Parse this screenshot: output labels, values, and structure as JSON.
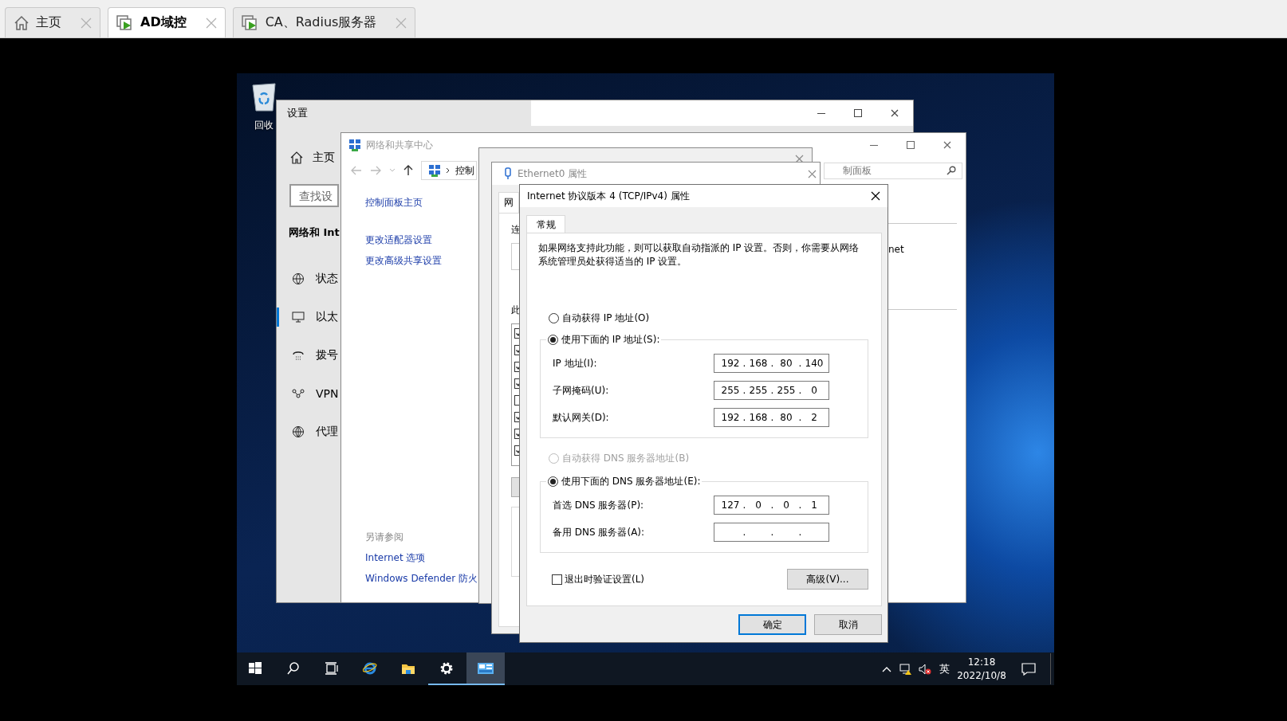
{
  "browser_tabs": [
    {
      "label": "主页",
      "kind": "home",
      "selected": false
    },
    {
      "label": "AD域控",
      "kind": "vm",
      "selected": true
    },
    {
      "label": "CA、Radius服务器",
      "kind": "vm",
      "selected": false
    }
  ],
  "desktop_icons": [
    {
      "label": "回收",
      "kind": "recycle"
    }
  ],
  "settings_window": {
    "title": "设置",
    "home_label": "主页",
    "search_placeholder": "查找设",
    "section_title": "网络和 Int",
    "nav": [
      {
        "label": "状态",
        "kind": "status",
        "selected": false
      },
      {
        "label": "以太",
        "kind": "ethernet",
        "selected": true
      },
      {
        "label": "拨号",
        "kind": "dialup",
        "selected": false
      },
      {
        "label": "VPN",
        "kind": "vpn",
        "selected": false
      },
      {
        "label": "代理",
        "kind": "proxy",
        "selected": false
      }
    ]
  },
  "network_center": {
    "title": "网络和共享中心",
    "address": "控制",
    "search_placeholder": "制面板",
    "links": [
      "控制面板主页",
      "更改适配器设置",
      "更改高级共享设置"
    ],
    "see_also_title": "另请参阅",
    "see_also": [
      "Internet 选项",
      "Windows Defender 防火"
    ],
    "right_text": "net"
  },
  "properties_window": {
    "title": "Ethernet0 属性",
    "tab": "网",
    "connect_label": "连",
    "items_label": "此",
    "items": [
      {
        "checked": true
      },
      {
        "checked": true
      },
      {
        "checked": true
      },
      {
        "checked": true
      },
      {
        "checked": false
      },
      {
        "checked": true
      },
      {
        "checked": true
      },
      {
        "checked": true
      }
    ]
  },
  "ipv4_dialog": {
    "title": "Internet 协议版本 4 (TCP/IPv4) 属性",
    "tabs": [
      {
        "label": "常规",
        "selected": true
      }
    ],
    "description": "如果网络支持此功能，则可以获取自动指派的 IP 设置。否则，你需要从网络系统管理员处获得适当的 IP 设置。",
    "octet_separator": ".",
    "ip_options": [
      {
        "label": "自动获得 IP 地址(O)",
        "selected": false,
        "disabled": false
      },
      {
        "label": "使用下面的 IP 地址(S):",
        "selected": true,
        "disabled": false
      }
    ],
    "ip_fields": [
      {
        "label": "IP 地址(I):",
        "octets": [
          "192",
          "168",
          "80",
          "140"
        ]
      },
      {
        "label": "子网掩码(U):",
        "octets": [
          "255",
          "255",
          "255",
          "0"
        ]
      },
      {
        "label": "默认网关(D):",
        "octets": [
          "192",
          "168",
          "80",
          "2"
        ]
      }
    ],
    "dns_options": [
      {
        "label": "自动获得 DNS 服务器地址(B)",
        "selected": false,
        "disabled": true
      },
      {
        "label": "使用下面的 DNS 服务器地址(E):",
        "selected": true,
        "disabled": false
      }
    ],
    "dns_fields": [
      {
        "label": "首选 DNS 服务器(P):",
        "octets": [
          "127",
          "0",
          "0",
          "1"
        ]
      },
      {
        "label": "备用 DNS 服务器(A):"
      }
    ],
    "validate_on_exit": {
      "label": "退出时验证设置(L)",
      "checked": false
    },
    "advanced_button": "高级(V)...",
    "buttons": [
      {
        "label": "确定",
        "kind": "default"
      },
      {
        "label": "取消",
        "kind": "normal"
      }
    ]
  },
  "taskbar": {
    "buttons": [
      {
        "kind": "start"
      },
      {
        "kind": "search"
      },
      {
        "kind": "taskview"
      }
    ],
    "apps": [
      {
        "kind": "browser",
        "running": false,
        "selected": false
      },
      {
        "kind": "folder",
        "running": false,
        "selected": false
      },
      {
        "kind": "settings",
        "running": true,
        "selected": false
      },
      {
        "kind": "panel",
        "running": true,
        "selected": true
      }
    ],
    "ime": "英",
    "time": "12:18",
    "date": "2022/10/8"
  }
}
